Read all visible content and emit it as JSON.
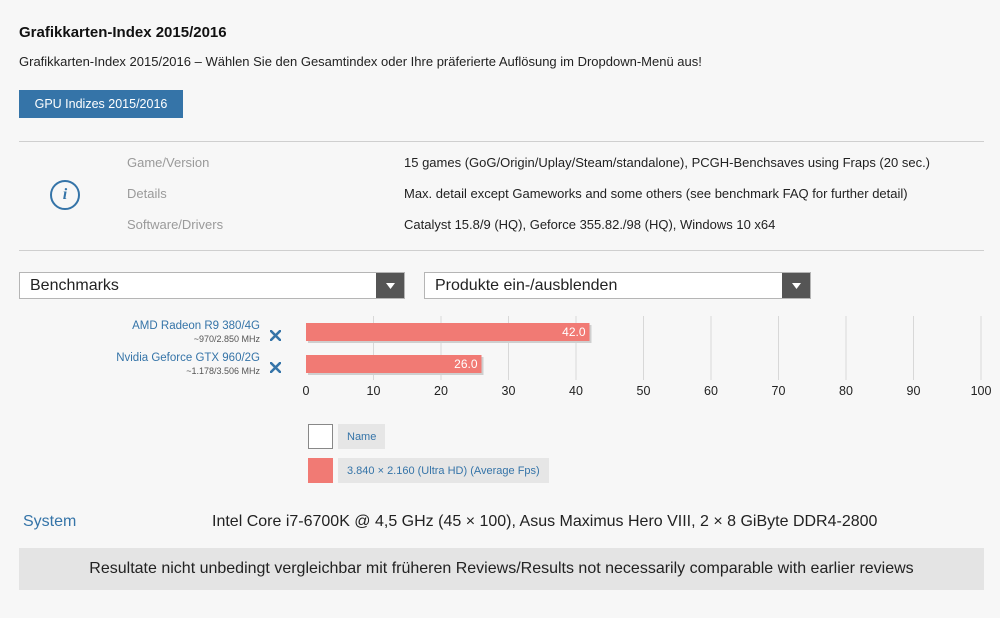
{
  "header": {
    "title": "Grafikkarten-Index 2015/2016",
    "subtitle": "Grafikkarten-Index 2015/2016 – Wählen Sie den Gesamtindex oder Ihre präferierte Auflösung im Dropdown-Menü aus!",
    "button_label": "GPU Indizes 2015/2016"
  },
  "info": {
    "icon_glyph": "i",
    "rows": [
      {
        "key": "Game/Version",
        "value": "15 games (GoG/Origin/Uplay/Steam/standalone), PCGH-Benchsaves using Fraps (20 sec.)"
      },
      {
        "key": "Details",
        "value": "Max. detail except Gameworks and some others (see benchmark FAQ for further detail)"
      },
      {
        "key": "Software/Drivers",
        "value": "Catalyst 15.8/9 (HQ), Geforce 355.82./98 (HQ), Windows 10 x64"
      }
    ]
  },
  "controls": {
    "benchmarks_select": "Benchmarks",
    "products_select": "Produkte ein-/ausblenden"
  },
  "gpus": [
    {
      "name": "AMD Radeon R9 380/4G",
      "clock": "~970/2.850 MHz"
    },
    {
      "name": "Nvidia Geforce GTX 960/2G",
      "clock": "~1.178/3.506 MHz"
    }
  ],
  "legend": [
    {
      "label": "Name",
      "swatch": "#ffffff"
    },
    {
      "label": "3.840 × 2.160 (Ultra HD) (Average Fps)",
      "swatch": "#f17a74"
    }
  ],
  "system": {
    "label": "System",
    "value": "Intel Core i7-6700K @ 4,5 GHz (45 × 100), Asus Maximus Hero VIII, 2 × 8 GiByte DDR4-2800"
  },
  "notice": "Resultate nicht unbedingt vergleichbar mit früheren Reviews/Results not necessarily comparable with earlier reviews",
  "colors": {
    "accent": "#3574a8",
    "bar": "#f17a74",
    "grid": "#d8d8d8"
  },
  "chart_data": {
    "type": "bar",
    "orientation": "horizontal",
    "categories": [
      "AMD Radeon R9 380/4G",
      "Nvidia Geforce GTX 960/2G"
    ],
    "series": [
      {
        "name": "3.840 × 2.160 (Ultra HD) (Average Fps)",
        "values": [
          42.0,
          26.0
        ],
        "color": "#f17a74"
      }
    ],
    "value_labels": [
      "42.0",
      "26.0"
    ],
    "xlim": [
      0,
      100
    ],
    "xticks": [
      0,
      10,
      20,
      30,
      40,
      50,
      60,
      70,
      80,
      90,
      100
    ],
    "grid": true,
    "legend_position": "bottom-left"
  }
}
